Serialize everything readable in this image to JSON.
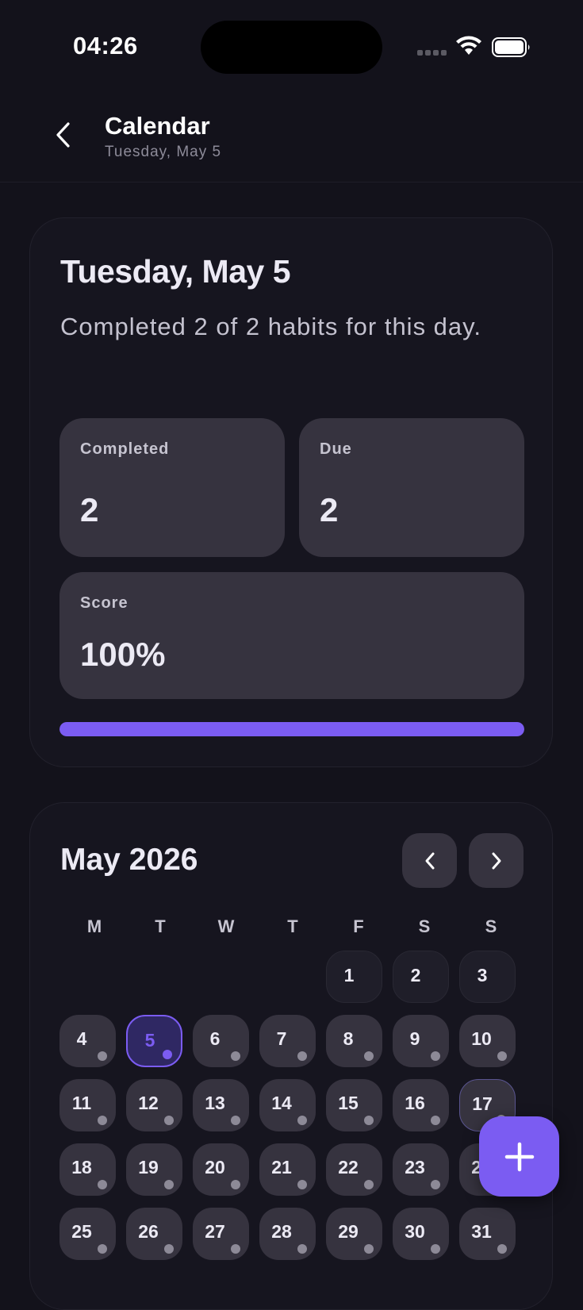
{
  "status_bar": {
    "time": "04:26"
  },
  "header": {
    "back_icon": "chevron-left-icon",
    "title": "Calendar",
    "subtitle": "Tuesday, May 5"
  },
  "summary": {
    "title": "Tuesday, May 5",
    "description": "Completed 2 of 2 habits for this day.",
    "completed_label": "Completed",
    "completed_value": "2",
    "due_label": "Due",
    "due_value": "2",
    "score_label": "Score",
    "score_value": "100%",
    "progress_fraction": 1.0
  },
  "calendar": {
    "month_title": "May 2026",
    "prev_icon": "chevron-left-icon",
    "next_icon": "chevron-right-icon",
    "weekdays": [
      "M",
      "T",
      "W",
      "T",
      "F",
      "S",
      "S"
    ],
    "first_weekday_index": 4,
    "days_in_month": 31,
    "selected_day": 5,
    "today": 17,
    "future_days_without_dot": [
      1,
      2,
      3
    ]
  },
  "fab": {
    "icon": "plus-icon"
  },
  "colors": {
    "accent": "#7b5cf2",
    "background": "#13121b",
    "tile": "#36333f"
  }
}
